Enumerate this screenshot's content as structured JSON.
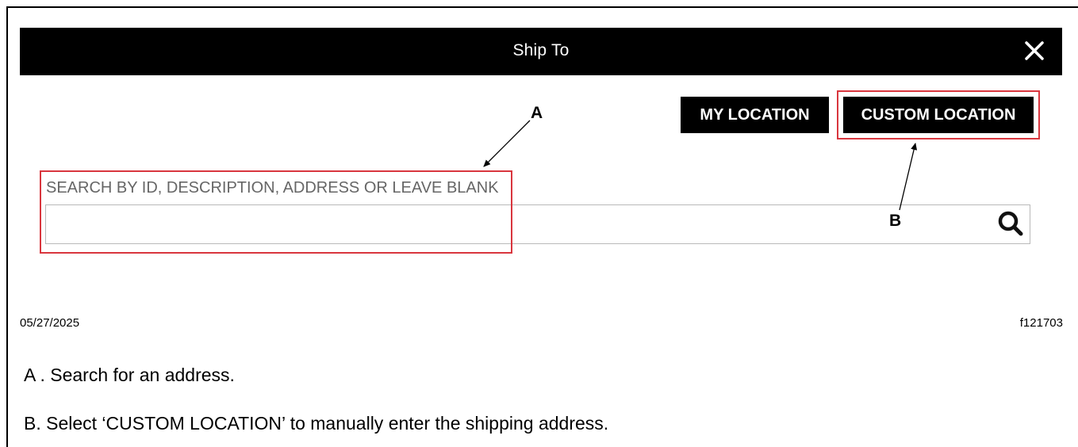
{
  "dialog": {
    "title": "Ship To",
    "close_icon": "close-icon"
  },
  "buttons": {
    "my_location": "MY LOCATION",
    "custom_location": "CUSTOM LOCATION"
  },
  "search": {
    "label": "SEARCH BY ID, DESCRIPTION, ADDRESS OR LEAVE BLANK",
    "value": "",
    "placeholder": "",
    "icon": "search-icon"
  },
  "callouts": {
    "a": "A",
    "b": "B",
    "highlight_color": "#d9363e"
  },
  "footer": {
    "date": "05/27/2025",
    "figure_code": "f121703"
  },
  "notes": {
    "a": "A . Search for an address.",
    "b": "B. Select ‘CUSTOM LOCATION’ to manually enter the shipping address."
  }
}
